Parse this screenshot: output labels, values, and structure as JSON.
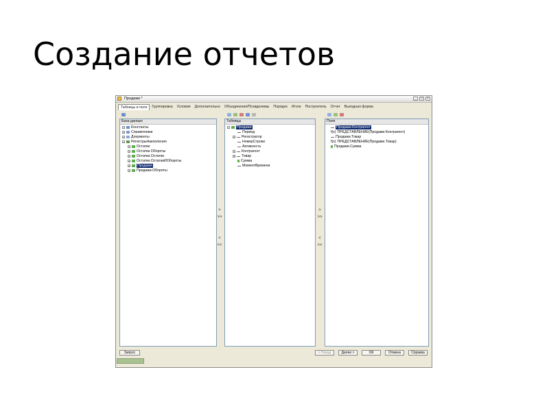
{
  "slide": {
    "title": "Создание отчетов"
  },
  "window": {
    "title": "Продажи *",
    "controls": {
      "minimize": "_",
      "maximize": "□",
      "close": "×"
    },
    "tabs": [
      {
        "label": "Таблицы и поля",
        "active": true
      },
      {
        "label": "Группировка"
      },
      {
        "label": "Условия"
      },
      {
        "label": "Дополнительно"
      },
      {
        "label": "Объединения/Псевдонимы"
      },
      {
        "label": "Порядок"
      },
      {
        "label": "Итоги"
      },
      {
        "label": "Построитель"
      },
      {
        "label": "Отчет"
      },
      {
        "label": "Выходная форма"
      }
    ],
    "database_panel": {
      "header": "База данных",
      "items": [
        {
          "label": "Константы",
          "expander": "+",
          "icon": "constants-icon"
        },
        {
          "label": "Справочники",
          "expander": "+",
          "icon": "catalogs-icon"
        },
        {
          "label": "Документы",
          "expander": "+",
          "icon": "documents-icon"
        },
        {
          "label": "РегистрыНакопления",
          "expander": "−",
          "icon": "registers-icon"
        },
        {
          "label": "Остатки",
          "expander": "+",
          "icon": "table-icon"
        },
        {
          "label": "Остатки.Обороты",
          "expander": "+",
          "icon": "table-icon"
        },
        {
          "label": "Остатки.Остатки",
          "expander": "+",
          "icon": "table-icon"
        },
        {
          "label": "Остатки.ОстаткиИОбороты",
          "expander": "+",
          "icon": "table-icon"
        },
        {
          "label": "Продажи",
          "expander": "+",
          "icon": "table-icon",
          "selected": true
        },
        {
          "label": "Продажи.Обороты",
          "expander": "+",
          "icon": "table-icon"
        }
      ]
    },
    "tables_panel": {
      "header": "Таблицы",
      "items": [
        {
          "label": "Продажи",
          "expander": "−",
          "selected": true
        },
        {
          "label": "Период"
        },
        {
          "label": "Регистратор",
          "expander": "+"
        },
        {
          "label": "НомерСтроки"
        },
        {
          "label": "Активность"
        },
        {
          "label": "Контрагент",
          "expander": "+"
        },
        {
          "label": "Товар",
          "expander": "+"
        },
        {
          "label": "Сумма"
        },
        {
          "label": "МоментВремени"
        }
      ]
    },
    "fields_panel": {
      "header": "Поля",
      "items": [
        {
          "label": "Продажи.Контрагент",
          "selected": true
        },
        {
          "label": "ПРЕДСТАВЛЕНИЕ(Продажи.Контрагент)",
          "prefix": "f(x)"
        },
        {
          "label": "Продажи.Товар"
        },
        {
          "label": "ПРЕДСТАВЛЕНИЕ(Продажи.Товар)",
          "prefix": "f(x)"
        },
        {
          "label": "Продажи.Сумма"
        }
      ]
    },
    "move_buttons": {
      "add": ">",
      "add_all": ">>",
      "remove": "<",
      "remove_all": "<<"
    },
    "buttons": {
      "query": "Запрос",
      "back": "< Назад",
      "next": "Далее >",
      "ok": "ОК",
      "cancel": "Отмена",
      "help": "Справка"
    }
  }
}
